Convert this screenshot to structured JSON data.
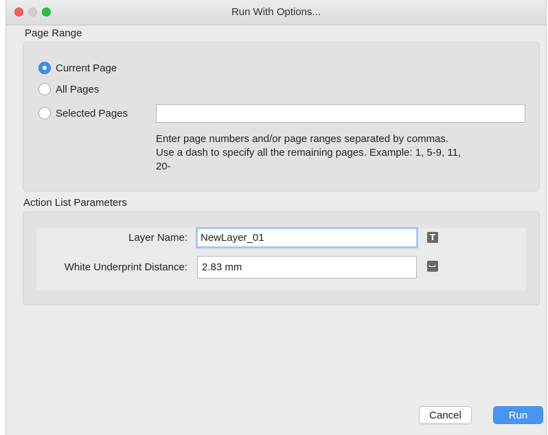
{
  "window": {
    "title": "Run With Options..."
  },
  "page_range": {
    "label": "Page Range",
    "options": [
      {
        "label": "Current Page",
        "checked": true
      },
      {
        "label": "All Pages",
        "checked": false
      },
      {
        "label": "Selected Pages",
        "checked": false
      }
    ],
    "selected_pages_value": "",
    "help_lines": [
      "Enter page numbers and/or page ranges separated by commas.",
      "Use a dash to specify all the remaining pages. Example: 1, 5-9, 11,",
      "20-"
    ]
  },
  "parameters": {
    "label": "Action List Parameters",
    "layer_name": {
      "label": "Layer Name:",
      "value": "NewLayer_01",
      "icon": "text-icon"
    },
    "underprint": {
      "label": "White Underprint Distance:",
      "value": "2.83 mm",
      "icon": "ruler-icon"
    }
  },
  "buttons": {
    "cancel": "Cancel",
    "run": "Run"
  },
  "colors": {
    "accent": "#4a95f2",
    "focus_ring": "#a6c7f3"
  }
}
